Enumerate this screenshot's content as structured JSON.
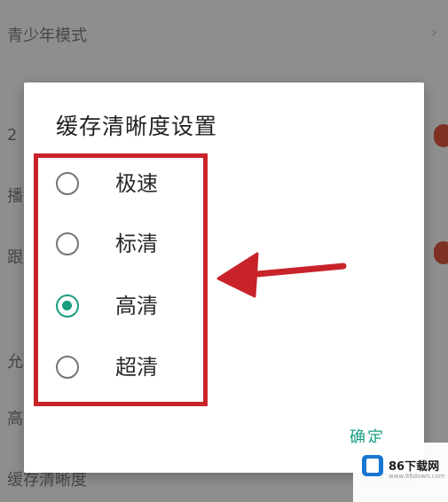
{
  "background": {
    "rows": [
      {
        "text": "青少年模式",
        "accessory": "chevron"
      },
      {
        "text": "2",
        "accessory": "toggle"
      },
      {
        "text": "播",
        "accessory": "none"
      },
      {
        "text": "跟",
        "accessory": "toggle"
      },
      {
        "text": "允",
        "accessory": "none"
      },
      {
        "text": "高",
        "accessory": "none"
      },
      {
        "text": "缓存清晰度",
        "accessory": "none"
      }
    ],
    "chevron_glyph": "›"
  },
  "dialog": {
    "title": "缓存清晰度设置",
    "options": [
      {
        "label": "极速",
        "selected": false
      },
      {
        "label": "标清",
        "selected": false
      },
      {
        "label": "高清",
        "selected": true
      },
      {
        "label": "超清",
        "selected": false
      }
    ],
    "confirm_label": "确定"
  },
  "watermark": {
    "brand": "86下载网",
    "url": "www.86down.com"
  },
  "colors": {
    "accent": "#1a9e80",
    "highlight": "#c8232a",
    "toggle": "#d9553d"
  }
}
